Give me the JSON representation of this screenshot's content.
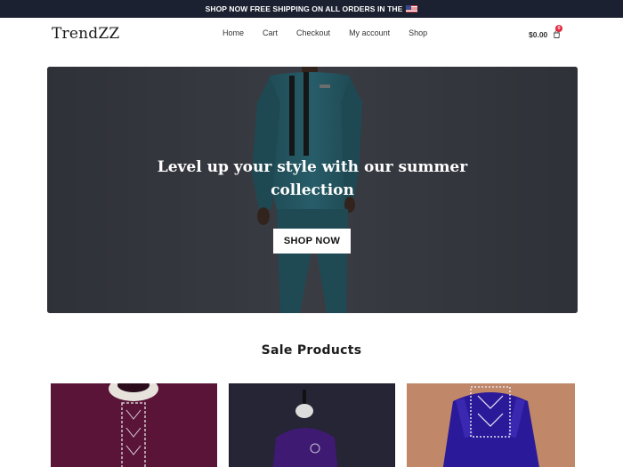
{
  "announcement": {
    "text": "SHOP NOW FREE SHIPPING ON ALL ORDERS IN THE",
    "flag_icon": "us-flag-icon"
  },
  "header": {
    "logo": "TrendZZ",
    "nav": [
      {
        "label": "Home"
      },
      {
        "label": "Cart"
      },
      {
        "label": "Checkout"
      },
      {
        "label": "My account"
      },
      {
        "label": "Shop"
      }
    ],
    "cart": {
      "amount": "$0.00",
      "count": "0",
      "icon": "shopping-bag-icon"
    }
  },
  "hero": {
    "headline": "Level up your style with our summer collection",
    "button_label": "SHOP NOW"
  },
  "sale": {
    "title": "Sale Products",
    "products": [
      {
        "name": "product-maroon-kaftan",
        "color": "#4d1030"
      },
      {
        "name": "product-purple-kaftan",
        "color": "#3e1a72"
      },
      {
        "name": "product-blue-kaftan",
        "color": "#2a1a9a"
      }
    ]
  },
  "colors": {
    "topbar": "#1b2130",
    "hero_bg": "#3a3c43",
    "badge": "#e2263d"
  }
}
